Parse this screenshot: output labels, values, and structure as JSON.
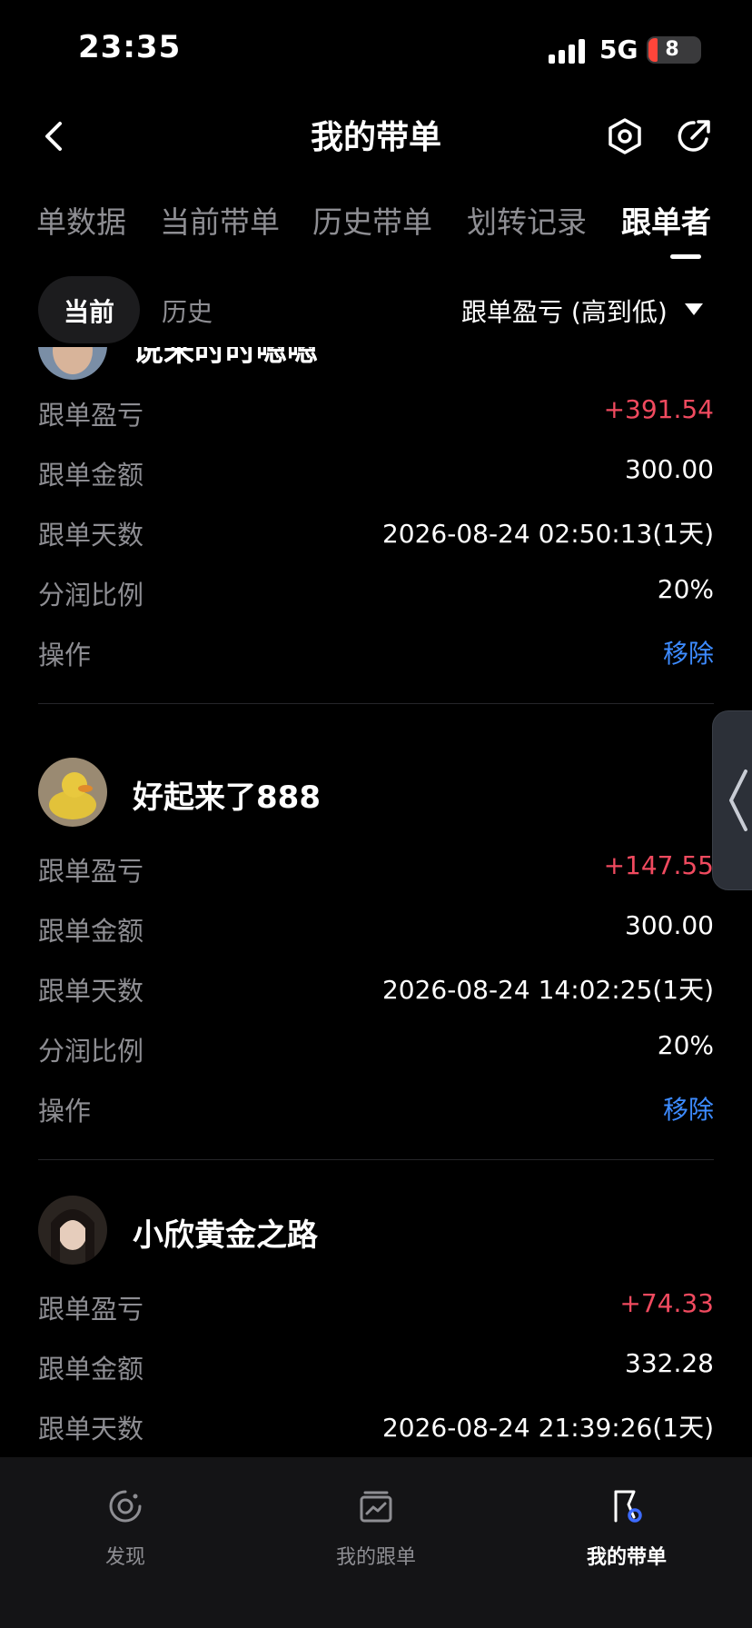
{
  "status_bar": {
    "time": "23:35",
    "network": "5G",
    "battery": "8"
  },
  "header": {
    "title": "我的带单",
    "icons": [
      "back-icon",
      "settings-icon",
      "share-icon"
    ]
  },
  "tabs": [
    {
      "label": "单数据"
    },
    {
      "label": "当前带单"
    },
    {
      "label": "历史带单"
    },
    {
      "label": "划转记录"
    },
    {
      "label": "跟单者",
      "active": true
    }
  ],
  "subtabs": {
    "current": "当前",
    "history": "历史",
    "sort_label": "跟单盈亏 (高到低)"
  },
  "followers": [
    {
      "name": "说来时时嗯嗯",
      "rows": [
        {
          "label": "跟单盈亏",
          "value": "+391.54"
        },
        {
          "label": "跟单金额",
          "value": "300.00"
        },
        {
          "label": "跟单天数",
          "value": "2026-08-24 02:50:13(1天)"
        },
        {
          "label": "分润比例",
          "value": "20%"
        },
        {
          "label": "操作",
          "value": "移除"
        }
      ]
    },
    {
      "name": "好起来了888",
      "rows": [
        {
          "label": "跟单盈亏",
          "value": "+147.55"
        },
        {
          "label": "跟单金额",
          "value": "300.00"
        },
        {
          "label": "跟单天数",
          "value": "2026-08-24 14:02:25(1天)"
        },
        {
          "label": "分润比例",
          "value": "20%"
        },
        {
          "label": "操作",
          "value": "移除"
        }
      ]
    },
    {
      "name": "小欣黄金之路",
      "rows": [
        {
          "label": "跟单盈亏",
          "value": "+74.33"
        },
        {
          "label": "跟单金额",
          "value": "332.28"
        },
        {
          "label": "跟单天数",
          "value": "2026-08-24 21:39:26(1天)"
        }
      ]
    }
  ],
  "bottom_nav": [
    {
      "label": "发现",
      "icon": "discover-icon"
    },
    {
      "label": "我的跟单",
      "icon": "chart-card-icon"
    },
    {
      "label": "我的带单",
      "icon": "flag-icon",
      "active": true
    }
  ],
  "colors": {
    "background": "#000000",
    "profit": "#f04a5f",
    "link": "#3d8bff",
    "muted": "#8e8e93"
  }
}
